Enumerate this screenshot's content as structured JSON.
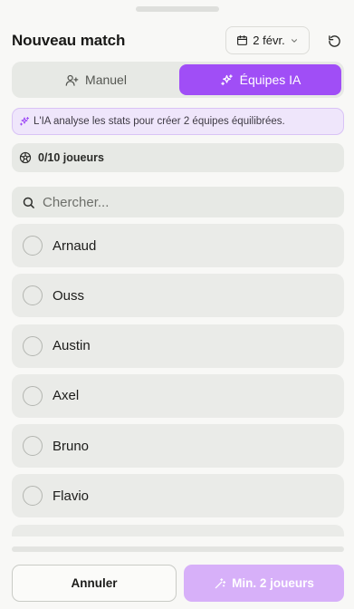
{
  "header": {
    "title": "Nouveau match",
    "date_label": "2 févr."
  },
  "mode_tabs": {
    "manual_label": "Manuel",
    "ai_label": "Équipes IA",
    "selected": "ai"
  },
  "ai_note": {
    "text": "L'IA analyse les stats pour créer 2 équipes équilibrées."
  },
  "player_count": {
    "text": "0/10 joueurs"
  },
  "search": {
    "placeholder": "Chercher...",
    "value": ""
  },
  "players": [
    {
      "name": "Arnaud",
      "selected": false
    },
    {
      "name": "Ouss",
      "selected": false
    },
    {
      "name": "Austin",
      "selected": false
    },
    {
      "name": "Axel",
      "selected": false
    },
    {
      "name": "Bruno",
      "selected": false
    },
    {
      "name": "Flavio",
      "selected": false
    }
  ],
  "footer": {
    "cancel_label": "Annuler",
    "create_label": "Min. 2 joueurs"
  },
  "colors": {
    "accent": "#a04ef6",
    "accent_disabled": "#d7b0f9",
    "surface": "#e7e9e5",
    "background": "#f8f8f6"
  },
  "icons": {
    "calendar": "calendar-icon",
    "reset": "rotate-ccw-icon",
    "manual": "user-plus-icon",
    "ai": "sparkles-icon",
    "count": "football-icon",
    "search": "search-icon",
    "create": "magic-wand-icon"
  }
}
